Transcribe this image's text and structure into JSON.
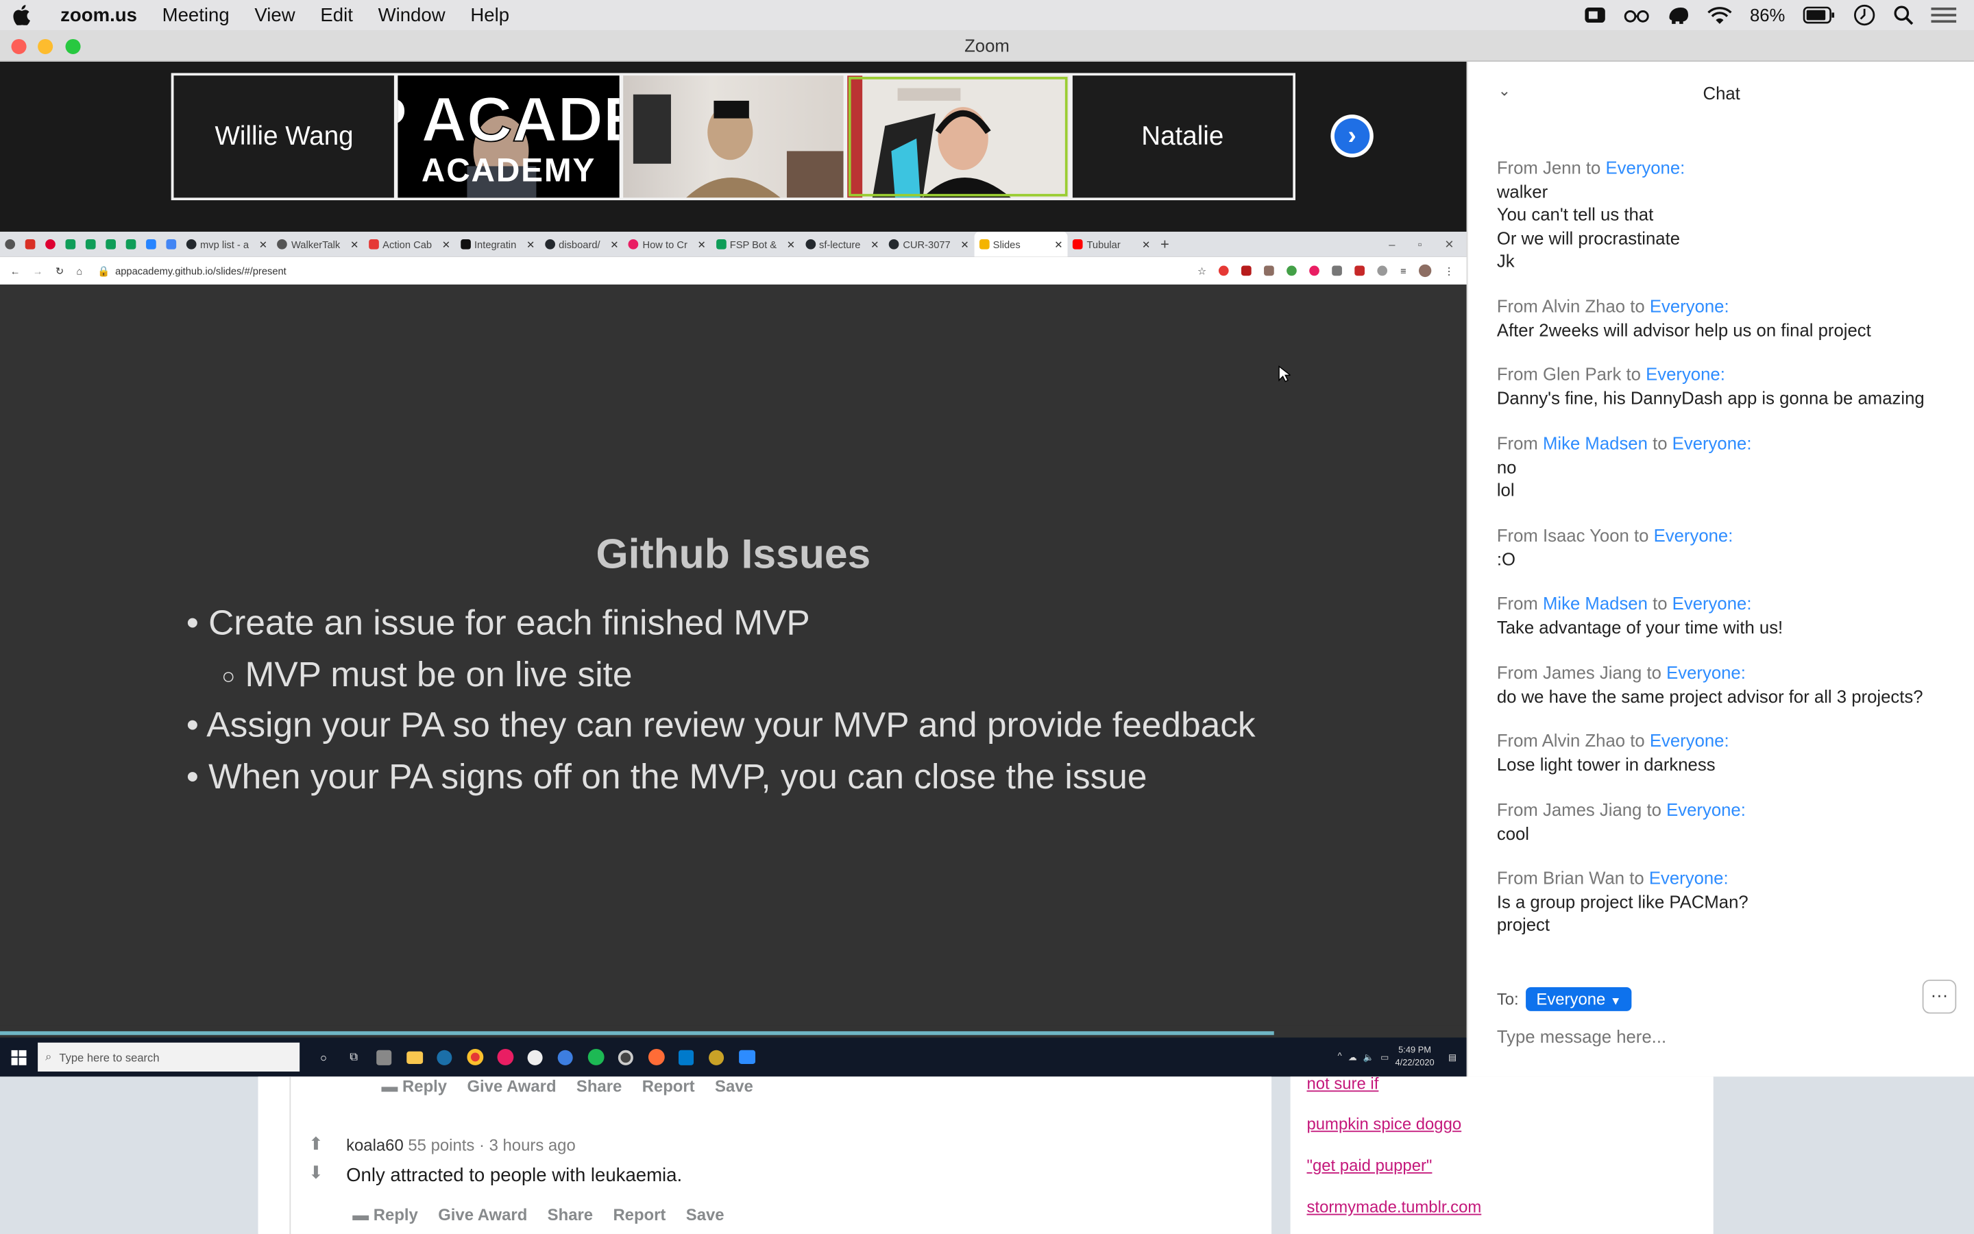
{
  "menubar": {
    "app": "zoom.us",
    "items": [
      "Meeting",
      "View",
      "Edit",
      "Window",
      "Help"
    ],
    "battery": "86%"
  },
  "window": {
    "title": "Zoom"
  },
  "participants": [
    {
      "name": "Willie Wang"
    },
    {
      "name": "",
      "logo": "APP ACADEMY"
    },
    {
      "name": ""
    },
    {
      "name": ""
    },
    {
      "name": "Natalie"
    }
  ],
  "browser": {
    "tabs": [
      "mvp list - a",
      "WalkerTalk",
      "Action Cab",
      "Integratin",
      "disboard/",
      "How to Cr",
      "FSP Bot &",
      "sf-lecture",
      "CUR-3077",
      "Slides",
      "Tubular"
    ],
    "url": "appacademy.github.io/slides/#/present"
  },
  "slide": {
    "title": "Github Issues",
    "bullets": [
      "Create an issue for each finished MVP",
      "MVP must be on live site",
      "Assign your PA so they can review your MVP and provide feedback",
      "When your PA signs off on the MVP, you can close the issue"
    ]
  },
  "taskbar": {
    "search": "Type here to search",
    "time": "5:49 PM",
    "date": "4/22/2020"
  },
  "webpage": {
    "actions": [
      "Reply",
      "Give Award",
      "Share",
      "Report",
      "Save"
    ],
    "comment": {
      "user": "koala60",
      "points": "55 points",
      "time": "3 hours ago",
      "text": "Only attracted to people with leukaemia."
    },
    "links": [
      "not sure if",
      "pumpkin spice doggo",
      "\"get paid pupper\"",
      "stormymade.tumblr.com"
    ]
  },
  "chat": {
    "title": "Chat",
    "messages": [
      {
        "from": "Jenn",
        "to": "Everyone",
        "lines": [
          "walker",
          "You can't tell us that",
          "Or we will procrastinate",
          "Jk"
        ]
      },
      {
        "from": "Alvin Zhao",
        "to": "Everyone",
        "lines": [
          "After 2weeks will advisor help us on final project"
        ]
      },
      {
        "from": "Glen Park",
        "to": "Everyone",
        "lines": [
          "Danny's fine, his DannyDash app is gonna be amazing"
        ]
      },
      {
        "from": "Mike Madsen",
        "to": "Everyone",
        "lines": [
          "no",
          "lol"
        ],
        "from_highlight": true
      },
      {
        "from": "Isaac Yoon",
        "to": "Everyone",
        "lines": [
          ":O"
        ]
      },
      {
        "from": "Mike Madsen",
        "to": "Everyone",
        "lines": [
          "Take advantage of your time with us!"
        ],
        "from_highlight": true
      },
      {
        "from": "James Jiang",
        "to": "Everyone",
        "lines": [
          "do we have the same project advisor for all 3 projects?"
        ]
      },
      {
        "from": "Alvin Zhao",
        "to": "Everyone",
        "lines": [
          "Lose light tower in darkness"
        ]
      },
      {
        "from": "James Jiang",
        "to": "Everyone",
        "lines": [
          "cool"
        ]
      },
      {
        "from": "Brian Wan",
        "to": "Everyone",
        "lines": [
          "Is a group project like PACMan?",
          "project"
        ]
      }
    ],
    "to_label": "To:",
    "recipient": "Everyone",
    "placeholder": "Type message here...",
    "from_word": "From",
    "to_word": "to"
  },
  "colors": {
    "accent": "#2d8cff",
    "link": "#c4187b",
    "zoom_blue": "#0e72ed"
  }
}
